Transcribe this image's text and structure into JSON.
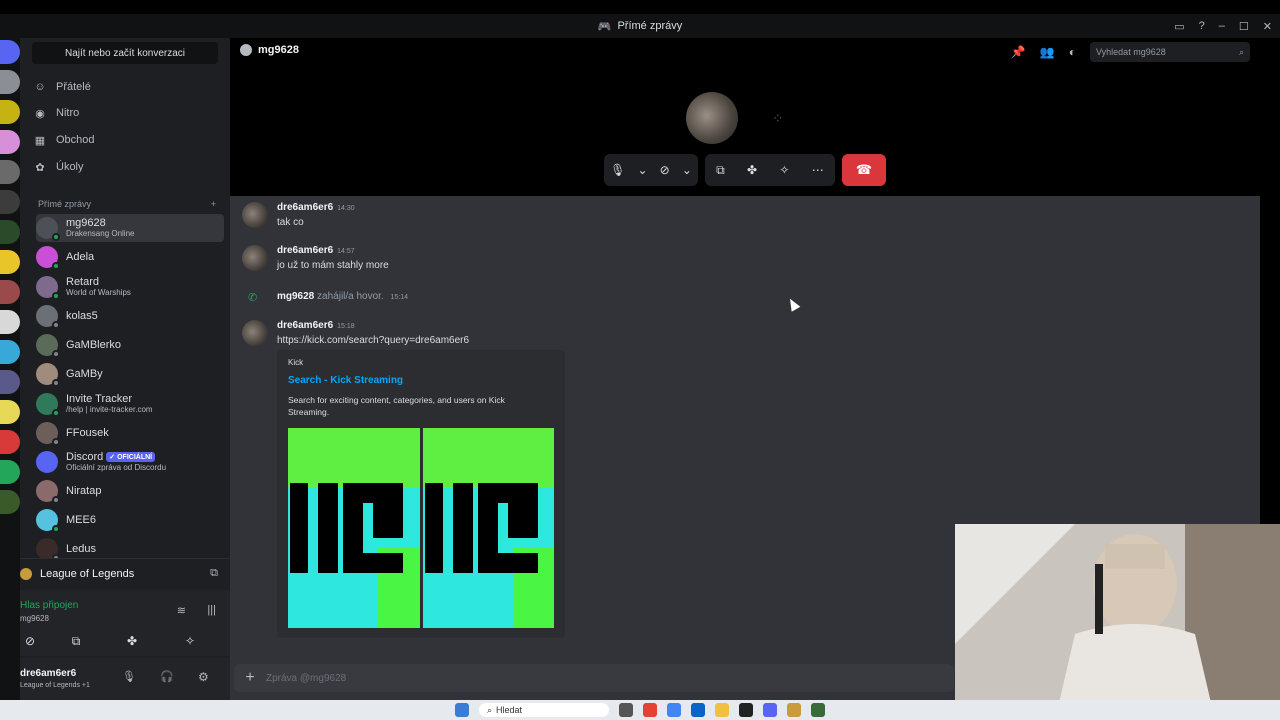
{
  "window": {
    "title": "Přímé zprávy"
  },
  "sidebar": {
    "search_label": "Najít nebo začít konverzaci",
    "nav": [
      {
        "label": "Přátelé",
        "icon": "friends-icon"
      },
      {
        "label": "Nitro",
        "icon": "nitro-icon"
      },
      {
        "label": "Obchod",
        "icon": "shop-icon"
      },
      {
        "label": "Úkoly",
        "icon": "quests-icon"
      }
    ],
    "dm_header": "Přímé zprávy",
    "dm_add": "+",
    "dms": [
      {
        "name": "mg9628",
        "sub": "Drakensang Online",
        "status": "online",
        "color": "#4e5058",
        "active": true
      },
      {
        "name": "Adela",
        "sub": "",
        "status": "online",
        "color": "#c94fd6"
      },
      {
        "name": "Retard",
        "sub": "World of Warships",
        "status": "online",
        "color": "#7c6b8c"
      },
      {
        "name": "kolas5",
        "sub": "",
        "status": "offline",
        "color": "#6b6f76"
      },
      {
        "name": "GaMBlerko",
        "sub": "",
        "status": "offline",
        "color": "#5a6b5a"
      },
      {
        "name": "GaMBy",
        "sub": "",
        "status": "offline",
        "color": "#a08c7c"
      },
      {
        "name": "Invite Tracker",
        "sub": "/help | invite-tracker.com",
        "status": "online",
        "color": "#2f7a5a"
      },
      {
        "name": "FFousek",
        "sub": "",
        "status": "offline",
        "color": "#6c5f5a"
      },
      {
        "name": "Discord",
        "badge": "✓ OFICIÁLNÍ",
        "sub": "Oficiální zpráva od Discordu",
        "status": "none",
        "color": "#5865f2"
      },
      {
        "name": "Niratap",
        "sub": "",
        "status": "offline",
        "color": "#8a6a6a"
      },
      {
        "name": "MEE6",
        "sub": "",
        "status": "online",
        "color": "#57c2e0"
      },
      {
        "name": "Ledus",
        "sub": "",
        "status": "offline",
        "color": "#3a2a2a"
      }
    ],
    "activity": "League of Legends",
    "voice": {
      "title": "Hlas připojen",
      "sub": "mg9628"
    },
    "user": {
      "name": "dre6am6er6",
      "sub": "League of Legends +1"
    }
  },
  "chat": {
    "header_name": "mg9628",
    "search_placeholder": "Vyhledat mg9628",
    "messages": [
      {
        "author": "dre6am6er6",
        "time": "14:30",
        "text": "tak co"
      },
      {
        "author": "dre6am6er6",
        "time": "14:57",
        "text": "jo už to mám stahly more"
      },
      {
        "author": "mg9628",
        "call_text": "zahájil/a hovor.",
        "time": "15:14"
      },
      {
        "author": "dre6am6er6",
        "time": "15:18",
        "link": "https://kick.com/search?query=dre6am6er6"
      }
    ],
    "embed": {
      "provider": "Kick",
      "title": "Search - Kick Streaming",
      "description": "Search for exciting content, categories, and users on Kick Streaming."
    },
    "composer_placeholder": "Zpráva @mg9628"
  },
  "taskbar": {
    "search": "Hledat"
  }
}
